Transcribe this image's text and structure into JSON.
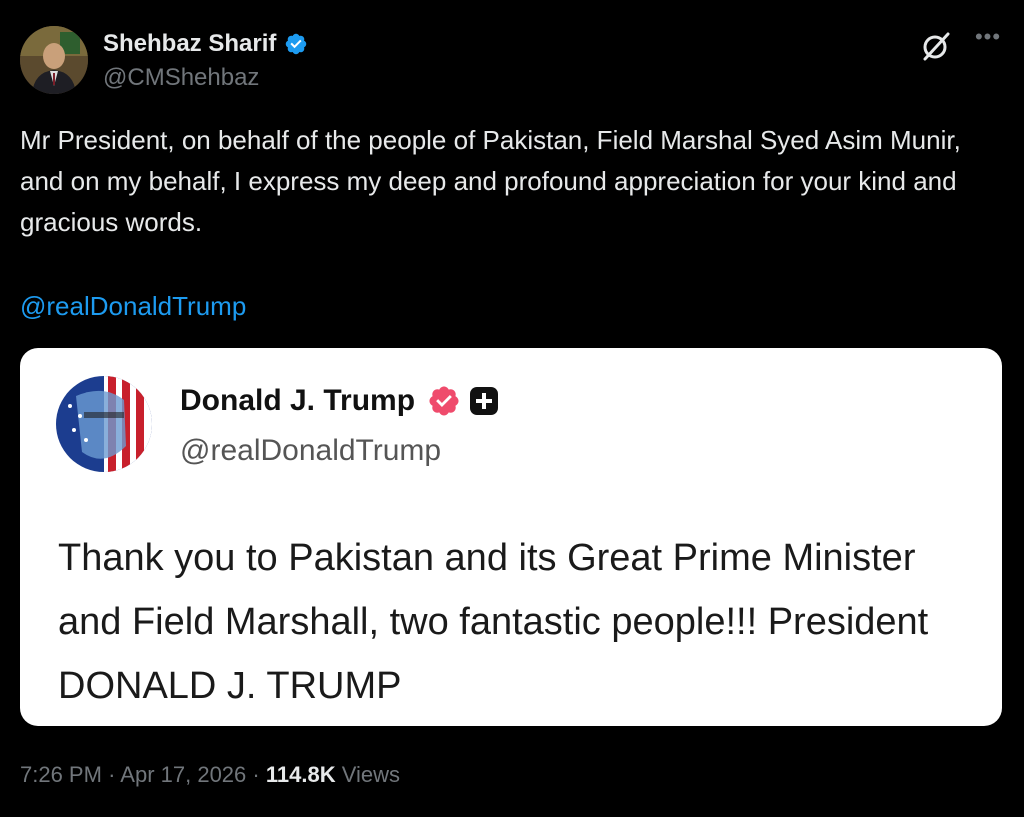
{
  "author": {
    "display_name": "Shehbaz Sharif",
    "handle": "@CMShehbaz",
    "verified_color": "#1d9bf0"
  },
  "tweet": {
    "text": "Mr President, on behalf of the people of Pakistan, Field Marshal Syed Asim Munir, and on my behalf, I express my deep and profound appreciation for your kind and gracious words.",
    "mention": "@realDonaldTrump"
  },
  "quoted": {
    "display_name": "Donald J. Trump",
    "handle": "@realDonaldTrump",
    "text": "Thank you to Pakistan and its Great Prime Minister and Field Marshall, two fantastic people!!! President DONALD J. TRUMP",
    "badge_color": "#ef4b6c"
  },
  "footer": {
    "time": "7:26 PM",
    "sep1": "·",
    "date": "Apr 17, 2026",
    "sep2": "·",
    "views_count": "114.8K",
    "views_label": "Views"
  },
  "icons": {
    "grok": "grok-icon",
    "more": "more-icon"
  }
}
